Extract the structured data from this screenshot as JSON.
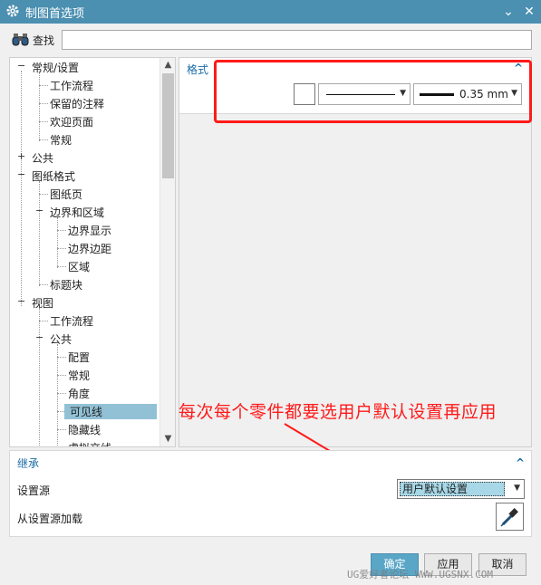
{
  "window": {
    "title": "制图首选项",
    "collapse_glyph": "⌄",
    "close_glyph": "✕"
  },
  "search": {
    "label": "查找",
    "value": "",
    "placeholder": ""
  },
  "tree": {
    "items": [
      {
        "label": "常规/设置",
        "expander": "−"
      },
      {
        "label": "工作流程"
      },
      {
        "label": "保留的注释"
      },
      {
        "label": "欢迎页面"
      },
      {
        "label": "常规"
      },
      {
        "label": "公共",
        "expander": "+"
      },
      {
        "label": "图纸格式",
        "expander": "−"
      },
      {
        "label": "图纸页"
      },
      {
        "label": "边界和区域",
        "expander": "−"
      },
      {
        "label": "边界显示"
      },
      {
        "label": "边界边距"
      },
      {
        "label": "区域"
      },
      {
        "label": "标题块"
      },
      {
        "label": "视图",
        "expander": "−"
      },
      {
        "label": "工作流程"
      },
      {
        "label": "公共",
        "expander": "−"
      },
      {
        "label": "配置"
      },
      {
        "label": "常规"
      },
      {
        "label": "角度"
      },
      {
        "label": "可见线",
        "selected": true
      },
      {
        "label": "隐藏线"
      },
      {
        "label": "虚拟交线"
      }
    ],
    "scroll_up": "▲",
    "scroll_down": "▼"
  },
  "format_section": {
    "title": "格式",
    "collapse_glyph": "^",
    "line_width": "0.35 mm",
    "caret": "▼"
  },
  "annotation": {
    "text": "每次每个零件都要选用户默认设置再应用"
  },
  "inherit_section": {
    "title": "继承",
    "collapse_glyph": "^",
    "source_label": "设置源",
    "source_value": "用户默认设置",
    "load_label": "从设置源加载",
    "caret": "▼"
  },
  "buttons": {
    "ok": "确定",
    "apply": "应用",
    "cancel": "取消"
  },
  "watermark": "UG爱好者论坛 WWW.UGSNX.COM",
  "colors": {
    "titlebar": "#4b8fb1",
    "accent": "#1a6ca6",
    "selection": "#92c1d6",
    "annotation_red": "#ff1a1a"
  }
}
